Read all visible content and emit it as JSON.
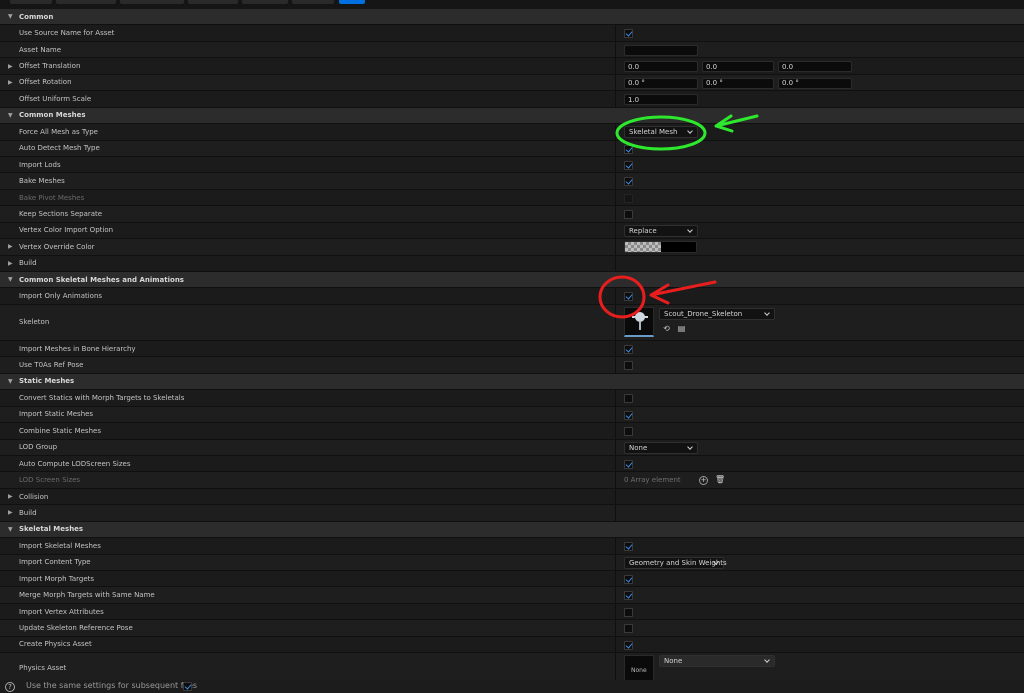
{
  "sections": {
    "common": "Common",
    "common_meshes": "Common Meshes",
    "common_skeletal": "Common Skeletal Meshes and Animations",
    "static_meshes": "Static Meshes",
    "skeletal_meshes": "Skeletal Meshes"
  },
  "common": {
    "use_source_name": "Use Source Name for Asset",
    "asset_name": "Asset Name",
    "offset_translation": "Offset Translation",
    "offset_translation_values": [
      "0.0",
      "0.0",
      "0.0"
    ],
    "offset_rotation": "Offset Rotation",
    "offset_rotation_values": [
      "0.0 °",
      "0.0 °",
      "0.0 °"
    ],
    "offset_uniform_scale": "Offset Uniform Scale",
    "offset_uniform_scale_value": "1.0"
  },
  "common_meshes": {
    "force_all_mesh": "Force All Mesh as Type",
    "force_all_mesh_value": "Skeletal Mesh",
    "auto_detect": "Auto Detect Mesh Type",
    "import_lods": "Import Lods",
    "bake_meshes": "Bake Meshes",
    "bake_pivot": "Bake Pivot Meshes",
    "keep_sections": "Keep Sections Separate",
    "vertex_color_option": "Vertex Color Import Option",
    "vertex_color_option_value": "Replace",
    "vertex_override_color": "Vertex Override Color",
    "build": "Build"
  },
  "common_skeletal": {
    "import_only_anim": "Import Only Animations",
    "skeleton": "Skeleton",
    "skeleton_value": "Scout_Drone_Skeleton",
    "import_bone_hierarchy": "Import Meshes in Bone Hierarchy",
    "use_t0": "Use T0As Ref Pose"
  },
  "static_meshes": {
    "convert_statics": "Convert Statics with Morph Targets to Skeletals",
    "import_static": "Import Static Meshes",
    "combine_static": "Combine Static Meshes",
    "lod_group": "LOD Group",
    "lod_group_value": "None",
    "auto_compute_lod": "Auto Compute LODScreen Sizes",
    "lod_screen_sizes": "LOD Screen Sizes",
    "lod_screen_sizes_value": "0 Array element",
    "collision": "Collision",
    "build": "Build"
  },
  "skeletal_meshes": {
    "import_skeletal": "Import Skeletal Meshes",
    "import_content_type": "Import Content Type",
    "import_content_type_value": "Geometry and Skin Weights",
    "import_morph": "Import Morph Targets",
    "merge_morph": "Merge Morph Targets with Same Name",
    "import_vertex_attr": "Import Vertex Attributes",
    "update_skeleton_ref": "Update Skeleton Reference Pose",
    "create_physics": "Create Physics Asset",
    "physics_asset": "Physics Asset",
    "physics_asset_value": "None",
    "physics_thumb_label": "None"
  },
  "footer": {
    "help_glyph": "?",
    "same_settings": "Use the same settings for subsequent files"
  },
  "checkbox_states": {
    "use_source_name": true,
    "auto_detect": true,
    "import_lods": true,
    "bake_meshes": true,
    "bake_pivot": false,
    "keep_sections": false,
    "import_only_anim": true,
    "import_bone_hierarchy": true,
    "use_t0": false,
    "convert_statics": false,
    "import_static": true,
    "combine_static": false,
    "auto_compute_lod": true,
    "import_skeletal": true,
    "import_morph": true,
    "merge_morph": true,
    "import_vertex_attr": false,
    "update_skeleton_ref": false,
    "create_physics": true,
    "same_settings": true
  },
  "colors": {
    "accent": "#0070e0",
    "checkmark": "#3b8ee8",
    "annotation_green": "#2ee82e",
    "annotation_red": "#e81e1e"
  },
  "icons": {
    "expand": "expand-arrow-icon",
    "collapse": "collapse-arrow-icon",
    "browse": "browse-asset-icon",
    "find": "find-in-browser-icon",
    "add": "add-element-icon",
    "delete": "trash-icon",
    "help": "help-icon"
  }
}
